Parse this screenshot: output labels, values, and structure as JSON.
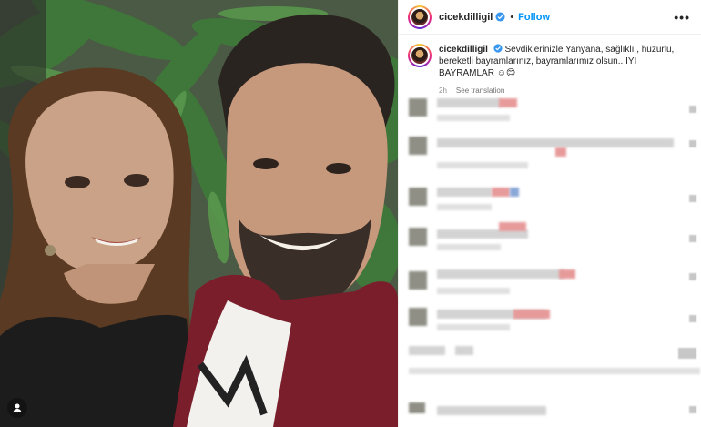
{
  "post": {
    "username": "cicekdilligil",
    "follow_label": "Follow",
    "separator": "•",
    "more_label": "•••",
    "caption_text": "Sevdiklerinizle Yanyana, sağlıklı , huzurlu, bereketli bayramlarınız, bayramlarımız olsun.. İYİ BAYRAMLAR ☺😊",
    "time_ago": "2h",
    "see_translation": "See translation"
  },
  "colors": {
    "follow": "#0095f6",
    "verified": "#3897f0",
    "meta": "#8e8e8e"
  },
  "icons": {
    "verified": "verified-badge-icon",
    "tag": "user-tag-icon",
    "more": "more-options-icon"
  }
}
